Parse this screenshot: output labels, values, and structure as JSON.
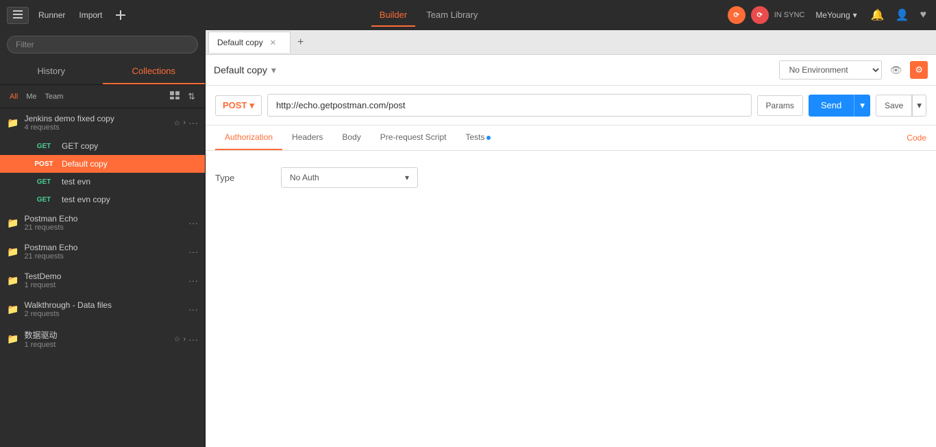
{
  "topbar": {
    "runner_label": "Runner",
    "import_label": "Import",
    "builder_label": "Builder",
    "team_library_label": "Team Library",
    "sync_status": "IN SYNC",
    "user_name": "MeYoung",
    "new_tab_title": "Default copy"
  },
  "sidebar": {
    "search_placeholder": "Filter",
    "history_tab": "History",
    "collections_tab": "Collections",
    "filter_all": "All",
    "filter_me": "Me",
    "filter_team": "Team",
    "items": [
      {
        "type": "folder",
        "name": "Jenkins demo fixed copy",
        "count": "4 requests",
        "has_star": true,
        "has_arrow": true
      },
      {
        "type": "request",
        "method": "GET",
        "name": "GET copy",
        "selected": false
      },
      {
        "type": "request",
        "method": "POST",
        "name": "Default copy",
        "selected": true
      },
      {
        "type": "request",
        "method": "GET",
        "name": "test evn",
        "selected": false
      },
      {
        "type": "request",
        "method": "GET",
        "name": "test evn copy",
        "selected": false
      },
      {
        "type": "folder",
        "name": "Postman Echo",
        "count": "21 requests"
      },
      {
        "type": "folder",
        "name": "Postman Echo",
        "count": "21 requests"
      },
      {
        "type": "folder",
        "name": "TestDemo",
        "count": "1 request"
      },
      {
        "type": "folder",
        "name": "Walkthrough - Data files",
        "count": "2 requests"
      },
      {
        "type": "folder",
        "name": "数据驱动",
        "count": "1 request",
        "has_star": true,
        "has_arrow": true
      }
    ]
  },
  "request": {
    "tab_name": "Default copy",
    "method": "POST",
    "url": "http://echo.getpostman.com/post",
    "params_label": "Params",
    "send_label": "Send",
    "save_label": "Save",
    "tabs": [
      "Authorization",
      "Headers",
      "Body",
      "Pre-request Script",
      "Tests"
    ],
    "active_tab": "Authorization",
    "tests_has_dot": true,
    "code_label": "Code"
  },
  "auth": {
    "type_label": "Type",
    "type_value": "No Auth"
  },
  "env": {
    "collection_name": "Default copy",
    "no_env_label": "No Environment"
  }
}
